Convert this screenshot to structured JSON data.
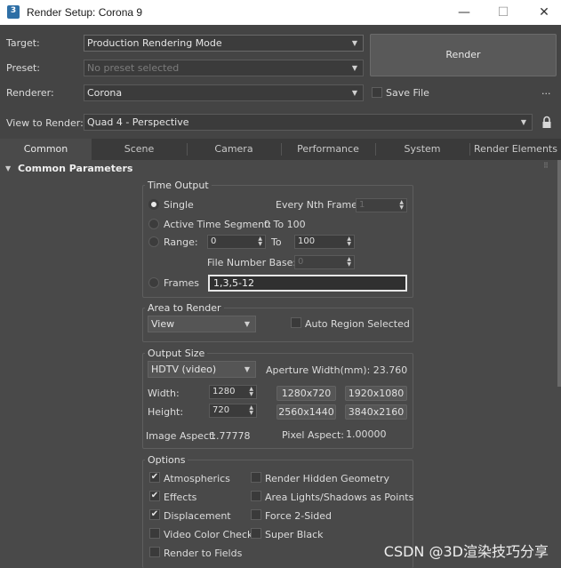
{
  "window": {
    "title": "Render Setup: Corona 9",
    "app_badge": "3",
    "minimize": "—",
    "maximize": "☐",
    "close": "✕"
  },
  "top": {
    "target_label": "Target:",
    "target_value": "Production Rendering Mode",
    "preset_label": "Preset:",
    "preset_value": "No preset selected",
    "renderer_label": "Renderer:",
    "renderer_value": "Corona",
    "save_file_label": "Save File",
    "save_file_checked": false,
    "more_label": "...",
    "view_label": "View to Render:",
    "view_value": "Quad 4 - Perspective",
    "render_button": "Render"
  },
  "tabs": [
    {
      "label": "Common",
      "active": true
    },
    {
      "label": "Scene",
      "active": false
    },
    {
      "label": "Camera",
      "active": false
    },
    {
      "label": "Performance",
      "active": false
    },
    {
      "label": "System",
      "active": false
    },
    {
      "label": "Render Elements",
      "active": false
    }
  ],
  "rollout": {
    "title": "Common Parameters",
    "time_output": {
      "title": "Time Output",
      "single": "Single",
      "every_nth_label": "Every Nth Frame:",
      "every_nth_value": "1",
      "active_segment": "Active Time Segment:",
      "active_segment_value": "0 To 100",
      "range": "Range:",
      "range_from": "0",
      "range_to_label": "To",
      "range_to": "100",
      "file_number_base_label": "File Number Base:",
      "file_number_base_value": "0",
      "frames": "Frames",
      "frames_value": "1,3,5-12"
    },
    "area": {
      "title": "Area to Render",
      "value": "View",
      "auto_region": "Auto Region Selected"
    },
    "output_size": {
      "title": "Output Size",
      "preset": "HDTV (video)",
      "aperture": "Aperture Width(mm): 23.760",
      "width_label": "Width:",
      "width_value": "1280",
      "height_label": "Height:",
      "height_value": "720",
      "presets": [
        "1280x720",
        "1920x1080",
        "2560x1440",
        "3840x2160"
      ],
      "image_aspect_label": "Image Aspect:",
      "image_aspect_value": "1.77778",
      "pixel_aspect_label": "Pixel Aspect:",
      "pixel_aspect_value": "1.00000"
    },
    "options": {
      "title": "Options",
      "left": [
        {
          "label": "Atmospherics",
          "checked": true
        },
        {
          "label": "Effects",
          "checked": true
        },
        {
          "label": "Displacement",
          "checked": true
        },
        {
          "label": "Video Color Check",
          "checked": false
        },
        {
          "label": "Render to Fields",
          "checked": false
        }
      ],
      "right": [
        {
          "label": "Render Hidden Geometry",
          "checked": false
        },
        {
          "label": "Area Lights/Shadows as Points",
          "checked": false
        },
        {
          "label": "Force 2-Sided",
          "checked": false
        },
        {
          "label": "Super Black",
          "checked": false
        }
      ]
    }
  },
  "watermark": "CSDN @3D渲染技巧分享",
  "icons": {
    "dropdown": "▼",
    "collapse": "▼",
    "lock": "lock-icon",
    "check": "✔"
  }
}
